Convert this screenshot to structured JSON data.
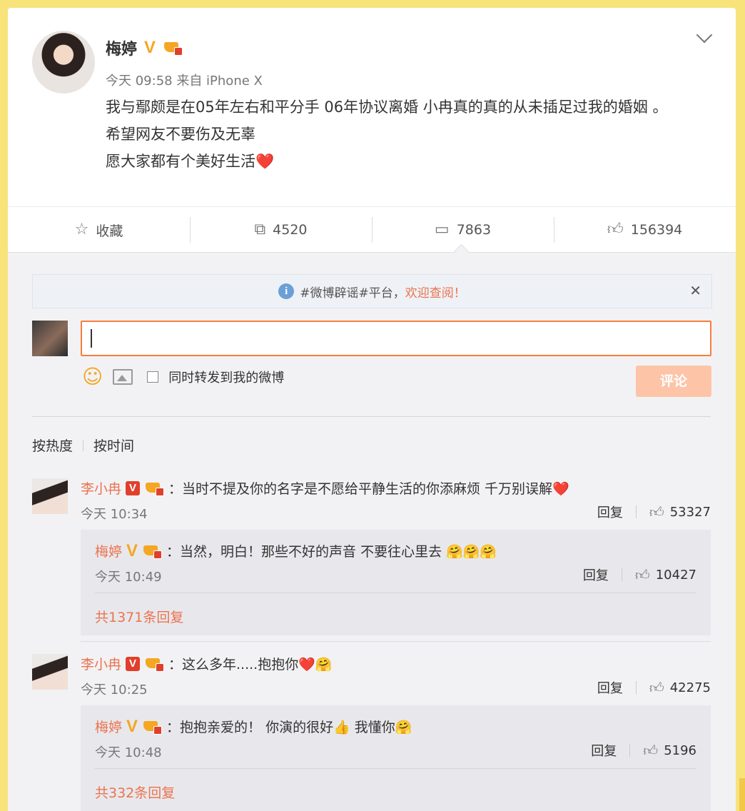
{
  "post": {
    "author": "梅婷",
    "meta": "今天 09:58 来自 iPhone X",
    "lines": [
      "我与鄢颇是在05年左右和平分手  06年协议离婚 小冉真的真的从未插足过我的婚姻 。",
      "希望网友不要伤及无辜",
      "愿大家都有个美好生活❤️"
    ]
  },
  "actions": {
    "favorite": "收藏",
    "repost": "4520",
    "comment": "7863",
    "like": "156394"
  },
  "notice": {
    "text": "#微博辟谣#平台，",
    "link": "欢迎查阅！"
  },
  "composer": {
    "checkbox_label": "同时转发到我的微博",
    "submit": "评论"
  },
  "sort": {
    "hot": "按热度",
    "time": "按时间"
  },
  "comments": [
    {
      "user": "李小冉",
      "text": "：当时不提及你的名字是不愿给平静生活的你添麻烦 千万别误解❤️",
      "time": "今天 10:34",
      "reply": "回复",
      "likes": "53327",
      "sub": {
        "user": "梅婷",
        "text": "：当然，明白！那些不好的声音 不要往心里去 🤗🤗🤗",
        "time": "今天 10:49",
        "reply": "回复",
        "likes": "10427",
        "more": "共1371条回复"
      }
    },
    {
      "user": "李小冉",
      "text": "：这么多年.....抱抱你❤️🤗",
      "time": "今天 10:25",
      "reply": "回复",
      "likes": "42275",
      "sub": {
        "user": "梅婷",
        "text": "：抱抱亲爱的！  你演的很好👍 我懂你🤗",
        "time": "今天 10:48",
        "reply": "回复",
        "likes": "5196",
        "more": "共332条回复"
      }
    }
  ]
}
